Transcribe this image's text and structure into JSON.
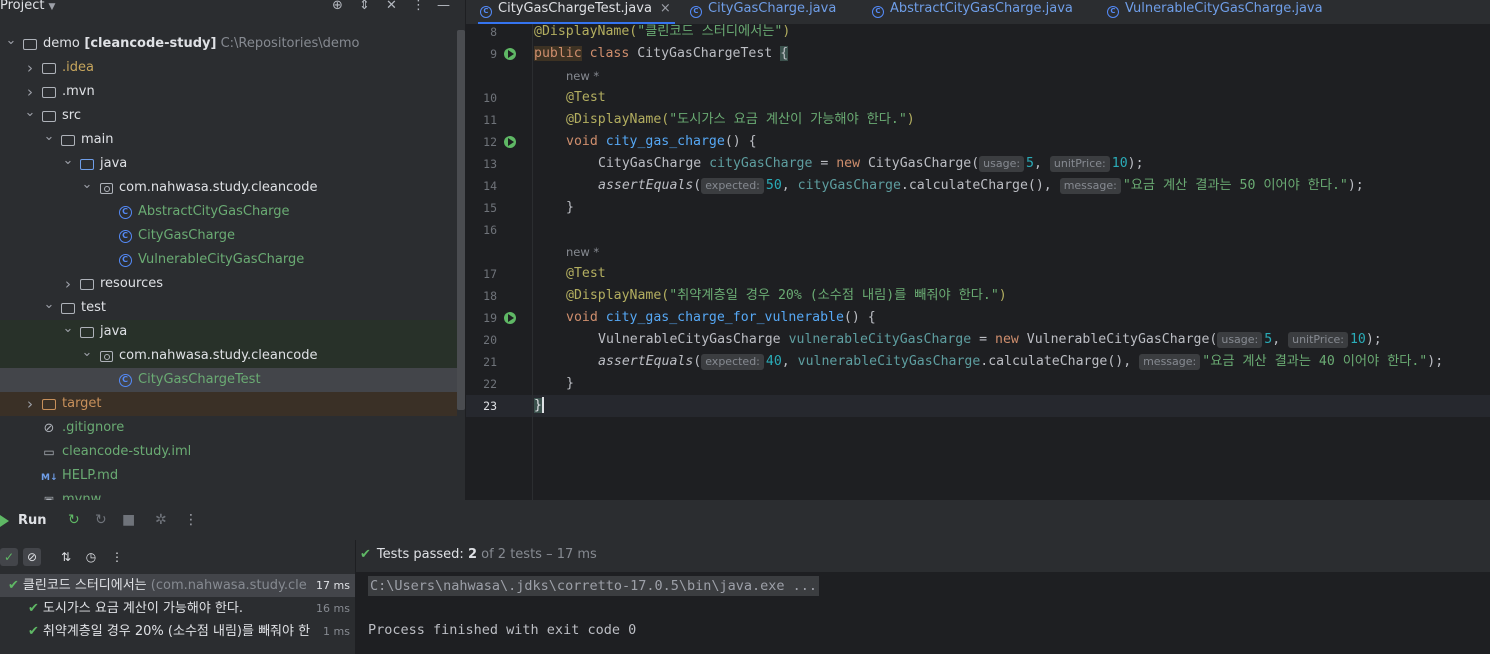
{
  "project": {
    "title": "Project",
    "tree": [
      {
        "indent": 0,
        "arrow": "down",
        "icon": "folder",
        "label": "demo",
        "label_bold": "[cleancode-study]",
        "path": "C:\\Repositories\\demo",
        "color": "#dfe1e5"
      },
      {
        "indent": 1,
        "arrow": "right",
        "icon": "folder",
        "label": ".idea",
        "color": "#c7a65d"
      },
      {
        "indent": 1,
        "arrow": "right",
        "icon": "folder",
        "label": ".mvn",
        "color": "#dfe1e5"
      },
      {
        "indent": 1,
        "arrow": "down",
        "icon": "folder",
        "label": "src",
        "color": "#dfe1e5"
      },
      {
        "indent": 2,
        "arrow": "down",
        "icon": "folder",
        "label": "main",
        "color": "#dfe1e5"
      },
      {
        "indent": 3,
        "arrow": "down",
        "icon": "folder-blue",
        "label": "java",
        "color": "#dfe1e5"
      },
      {
        "indent": 4,
        "arrow": "down",
        "icon": "package",
        "label": "com.nahwasa.study.cleancode",
        "color": "#dfe1e5"
      },
      {
        "indent": 5,
        "arrow": "",
        "icon": "class",
        "label": "AbstractCityGasCharge",
        "color": "#6aab73"
      },
      {
        "indent": 5,
        "arrow": "",
        "icon": "class",
        "label": "CityGasCharge",
        "color": "#6aab73"
      },
      {
        "indent": 5,
        "arrow": "",
        "icon": "class",
        "label": "VulnerableCityGasCharge",
        "color": "#6aab73"
      },
      {
        "indent": 3,
        "arrow": "right",
        "icon": "folder-res",
        "label": "resources",
        "color": "#dfe1e5"
      },
      {
        "indent": 2,
        "arrow": "down",
        "icon": "folder",
        "label": "test",
        "color": "#dfe1e5"
      },
      {
        "indent": 3,
        "arrow": "down",
        "icon": "folder-green",
        "label": "java",
        "color": "#dfe1e5",
        "bg": "test"
      },
      {
        "indent": 4,
        "arrow": "down",
        "icon": "package",
        "label": "com.nahwasa.study.cleancode",
        "color": "#dfe1e5",
        "bg": "test"
      },
      {
        "indent": 5,
        "arrow": "",
        "icon": "class",
        "label": "CityGasChargeTest",
        "color": "#6aab73",
        "bg": "sel"
      },
      {
        "indent": 1,
        "arrow": "right",
        "icon": "folder-orange",
        "label": "target",
        "color": "#c7905b",
        "bg": "target"
      },
      {
        "indent": 1,
        "arrow": "",
        "icon": "ignore",
        "label": ".gitignore",
        "color": "#6aab73"
      },
      {
        "indent": 1,
        "arrow": "",
        "icon": "iml",
        "label": "cleancode-study.iml",
        "color": "#6aab73"
      },
      {
        "indent": 1,
        "arrow": "",
        "icon": "md",
        "label": "HELP.md",
        "color": "#6aab73"
      },
      {
        "indent": 1,
        "arrow": "",
        "icon": "file",
        "label": "mvnw",
        "color": "#6aab73"
      }
    ]
  },
  "tabs": [
    {
      "label": "CityGasChargeTest.java",
      "active": true
    },
    {
      "label": "CityGasCharge.java",
      "active": false
    },
    {
      "label": "AbstractCityGasCharge.java",
      "active": false
    },
    {
      "label": "VulnerableCityGasCharge.java",
      "active": false
    }
  ],
  "editor": {
    "new_hint": "new *",
    "line_numbers": [
      "8",
      "9",
      "10",
      "11",
      "12",
      "13",
      "14",
      "15",
      "16",
      "17",
      "18",
      "19",
      "20",
      "21",
      "22",
      "23"
    ],
    "line8": {
      "ann": "@DisplayName(",
      "str": "\"클린코드 스터디에서는\"",
      "close": ")"
    },
    "line9": {
      "kw1": "public",
      "kw2": "class",
      "name": "CityGasChargeTest",
      "brace": "{"
    },
    "line10": {
      "ann": "@Test"
    },
    "line11": {
      "ann": "@DisplayName(",
      "str": "\"도시가스 요금 계산이 가능해야 한다.\"",
      "close": ")"
    },
    "line12": {
      "kw": "void",
      "fn": "city_gas_charge",
      "rest": "() {"
    },
    "line13": {
      "type": "CityGasCharge",
      "var": "cityGasCharge",
      "eq": " = ",
      "kw": "new",
      "ctor": " CityGasCharge(",
      "hint1": "usage:",
      "v1": "5",
      "sep": ", ",
      "hint2": "unitPrice:",
      "v2": "10",
      "end": ");"
    },
    "line14": {
      "fn": "assertEquals",
      "open": "(",
      "hint1": "expected:",
      "v1": "50",
      "sep1": ", ",
      "var": "cityGasCharge",
      "call": ".calculateCharge(), ",
      "hint2": "message:",
      "str": "\"요금 계산 결과는 50 이어야 한다.\"",
      "end": ");"
    },
    "line15": {
      "text": "}"
    },
    "line17": {
      "ann": "@Test"
    },
    "line18": {
      "ann": "@DisplayName(",
      "str": "\"취약계층일 경우 20% (소수점 내림)를 빼줘야 한다.\"",
      "close": ")"
    },
    "line19": {
      "kw": "void",
      "fn": "city_gas_charge_for_vulnerable",
      "rest": "() {"
    },
    "line20": {
      "type": "VulnerableCityGasCharge",
      "var": "vulnerableCityGasCharge",
      "eq": " = ",
      "kw": "new",
      "ctor": " VulnerableCityGasCharge(",
      "hint1": "usage:",
      "v1": "5",
      "sep": ", ",
      "hint2": "unitPrice:",
      "v2": "10",
      "end": ");"
    },
    "line21": {
      "fn": "assertEquals",
      "open": "(",
      "hint1": "expected:",
      "v1": "40",
      "sep1": ", ",
      "var": "vulnerableCityGasCharge",
      "call": ".calculateCharge(), ",
      "hint2": "message:",
      "str": "\"요금 계산 결과는 40 이어야 한다.\"",
      "end": ");"
    },
    "line22": {
      "text": "}"
    },
    "line23": {
      "text": "}"
    }
  },
  "run": {
    "title": "Run",
    "summary_label": "Tests passed:",
    "summary_count": "2",
    "summary_rest": "of 2 tests – 17 ms",
    "tests": [
      {
        "label": "클린코드 스터디에서는",
        "sub": "(com.nahwasa.study.cle",
        "duration": "17 ms",
        "indent": 0,
        "selected": true
      },
      {
        "label": "도시가스 요금 계산이 가능해야 한다.",
        "sub": "",
        "duration": "16 ms",
        "indent": 1,
        "selected": false
      },
      {
        "label": "취약계층일 경우 20% (소수점 내림)를 빼줘야 한",
        "sub": "",
        "duration": "1 ms",
        "indent": 1,
        "selected": false
      }
    ],
    "console_cmd": "C:\\Users\\nahwasa\\.jdks\\corretto-17.0.5\\bin\\java.exe ...",
    "console_exit": "Process finished with exit code 0"
  }
}
